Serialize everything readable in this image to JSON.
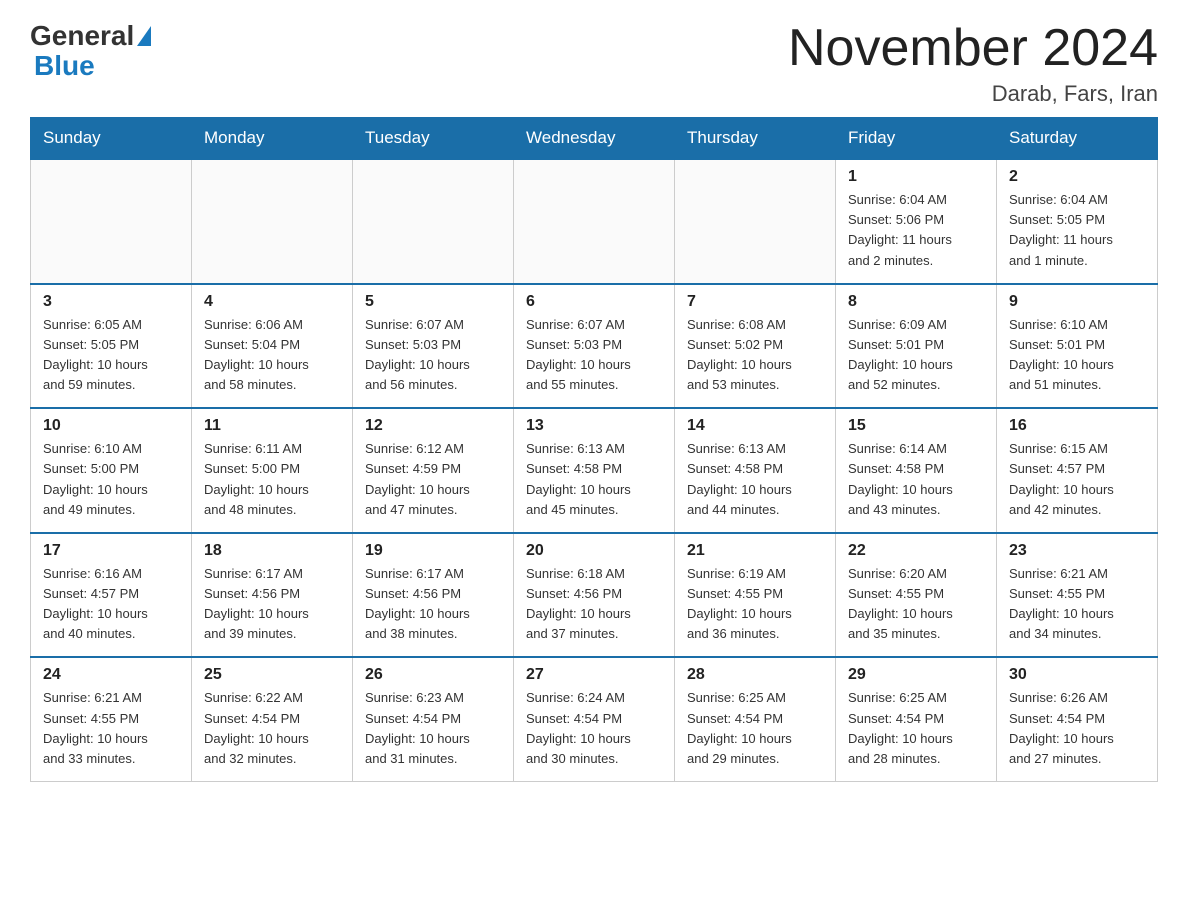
{
  "header": {
    "logo": {
      "general": "General",
      "blue": "Blue"
    },
    "title": "November 2024",
    "location": "Darab, Fars, Iran"
  },
  "weekdays": [
    "Sunday",
    "Monday",
    "Tuesday",
    "Wednesday",
    "Thursday",
    "Friday",
    "Saturday"
  ],
  "weeks": [
    [
      {
        "day": "",
        "info": ""
      },
      {
        "day": "",
        "info": ""
      },
      {
        "day": "",
        "info": ""
      },
      {
        "day": "",
        "info": ""
      },
      {
        "day": "",
        "info": ""
      },
      {
        "day": "1",
        "info": "Sunrise: 6:04 AM\nSunset: 5:06 PM\nDaylight: 11 hours\nand 2 minutes."
      },
      {
        "day": "2",
        "info": "Sunrise: 6:04 AM\nSunset: 5:05 PM\nDaylight: 11 hours\nand 1 minute."
      }
    ],
    [
      {
        "day": "3",
        "info": "Sunrise: 6:05 AM\nSunset: 5:05 PM\nDaylight: 10 hours\nand 59 minutes."
      },
      {
        "day": "4",
        "info": "Sunrise: 6:06 AM\nSunset: 5:04 PM\nDaylight: 10 hours\nand 58 minutes."
      },
      {
        "day": "5",
        "info": "Sunrise: 6:07 AM\nSunset: 5:03 PM\nDaylight: 10 hours\nand 56 minutes."
      },
      {
        "day": "6",
        "info": "Sunrise: 6:07 AM\nSunset: 5:03 PM\nDaylight: 10 hours\nand 55 minutes."
      },
      {
        "day": "7",
        "info": "Sunrise: 6:08 AM\nSunset: 5:02 PM\nDaylight: 10 hours\nand 53 minutes."
      },
      {
        "day": "8",
        "info": "Sunrise: 6:09 AM\nSunset: 5:01 PM\nDaylight: 10 hours\nand 52 minutes."
      },
      {
        "day": "9",
        "info": "Sunrise: 6:10 AM\nSunset: 5:01 PM\nDaylight: 10 hours\nand 51 minutes."
      }
    ],
    [
      {
        "day": "10",
        "info": "Sunrise: 6:10 AM\nSunset: 5:00 PM\nDaylight: 10 hours\nand 49 minutes."
      },
      {
        "day": "11",
        "info": "Sunrise: 6:11 AM\nSunset: 5:00 PM\nDaylight: 10 hours\nand 48 minutes."
      },
      {
        "day": "12",
        "info": "Sunrise: 6:12 AM\nSunset: 4:59 PM\nDaylight: 10 hours\nand 47 minutes."
      },
      {
        "day": "13",
        "info": "Sunrise: 6:13 AM\nSunset: 4:58 PM\nDaylight: 10 hours\nand 45 minutes."
      },
      {
        "day": "14",
        "info": "Sunrise: 6:13 AM\nSunset: 4:58 PM\nDaylight: 10 hours\nand 44 minutes."
      },
      {
        "day": "15",
        "info": "Sunrise: 6:14 AM\nSunset: 4:58 PM\nDaylight: 10 hours\nand 43 minutes."
      },
      {
        "day": "16",
        "info": "Sunrise: 6:15 AM\nSunset: 4:57 PM\nDaylight: 10 hours\nand 42 minutes."
      }
    ],
    [
      {
        "day": "17",
        "info": "Sunrise: 6:16 AM\nSunset: 4:57 PM\nDaylight: 10 hours\nand 40 minutes."
      },
      {
        "day": "18",
        "info": "Sunrise: 6:17 AM\nSunset: 4:56 PM\nDaylight: 10 hours\nand 39 minutes."
      },
      {
        "day": "19",
        "info": "Sunrise: 6:17 AM\nSunset: 4:56 PM\nDaylight: 10 hours\nand 38 minutes."
      },
      {
        "day": "20",
        "info": "Sunrise: 6:18 AM\nSunset: 4:56 PM\nDaylight: 10 hours\nand 37 minutes."
      },
      {
        "day": "21",
        "info": "Sunrise: 6:19 AM\nSunset: 4:55 PM\nDaylight: 10 hours\nand 36 minutes."
      },
      {
        "day": "22",
        "info": "Sunrise: 6:20 AM\nSunset: 4:55 PM\nDaylight: 10 hours\nand 35 minutes."
      },
      {
        "day": "23",
        "info": "Sunrise: 6:21 AM\nSunset: 4:55 PM\nDaylight: 10 hours\nand 34 minutes."
      }
    ],
    [
      {
        "day": "24",
        "info": "Sunrise: 6:21 AM\nSunset: 4:55 PM\nDaylight: 10 hours\nand 33 minutes."
      },
      {
        "day": "25",
        "info": "Sunrise: 6:22 AM\nSunset: 4:54 PM\nDaylight: 10 hours\nand 32 minutes."
      },
      {
        "day": "26",
        "info": "Sunrise: 6:23 AM\nSunset: 4:54 PM\nDaylight: 10 hours\nand 31 minutes."
      },
      {
        "day": "27",
        "info": "Sunrise: 6:24 AM\nSunset: 4:54 PM\nDaylight: 10 hours\nand 30 minutes."
      },
      {
        "day": "28",
        "info": "Sunrise: 6:25 AM\nSunset: 4:54 PM\nDaylight: 10 hours\nand 29 minutes."
      },
      {
        "day": "29",
        "info": "Sunrise: 6:25 AM\nSunset: 4:54 PM\nDaylight: 10 hours\nand 28 minutes."
      },
      {
        "day": "30",
        "info": "Sunrise: 6:26 AM\nSunset: 4:54 PM\nDaylight: 10 hours\nand 27 minutes."
      }
    ]
  ]
}
